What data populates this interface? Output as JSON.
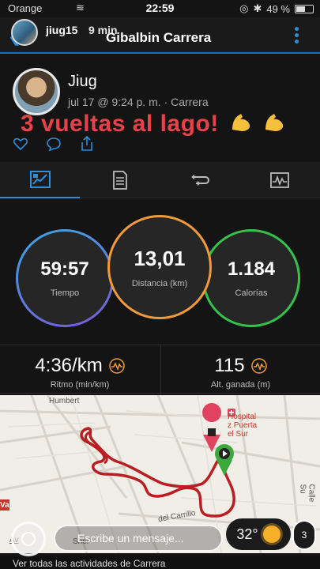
{
  "status_bar": {
    "carrier": "Orange",
    "time": "22:59",
    "battery": "49 %"
  },
  "ig_overlay": {
    "username": "jiug15",
    "time_ago": "9 min",
    "message_placeholder": "Escribe un mensaje...",
    "temperature": "32°",
    "counter": "3"
  },
  "header": {
    "title": "Gibalbin Carrera"
  },
  "profile": {
    "name": "Jiug",
    "meta": "jul 17 @ 9:24 p. m. · Carrera"
  },
  "caption": "3 vueltas al lago!",
  "tabs": [
    "overview-tab",
    "details-tab",
    "laps-tab",
    "charts-tab"
  ],
  "metrics": {
    "time": {
      "value": "59:57",
      "label": "Tiempo"
    },
    "distance": {
      "value": "13,01",
      "label": "Distancia (km)"
    },
    "calories": {
      "value": "1.184",
      "label": "Calorías"
    },
    "pace": {
      "value": "4:36/km",
      "label": "Ritmo (min/km)"
    },
    "elevation": {
      "value": "115",
      "label": "Alt. ganada (m)"
    }
  },
  "map": {
    "labels": {
      "humbert": "Humbert",
      "hospital": "Hospital\nz Puerta\nel Sur",
      "calle": "Calle Su",
      "carrillo": "del Carrillo",
      "sher": "Sher",
      "av": "Av",
      "va": "Va"
    }
  },
  "colors": {
    "accent": "#2b8fe0",
    "distance_ring": "#f29a3a",
    "calories_ring": "#33c24a",
    "caption": "#e8414a",
    "route": "#b81e22"
  },
  "footer": {
    "text": "Ver todas las actividades de Carrera"
  }
}
